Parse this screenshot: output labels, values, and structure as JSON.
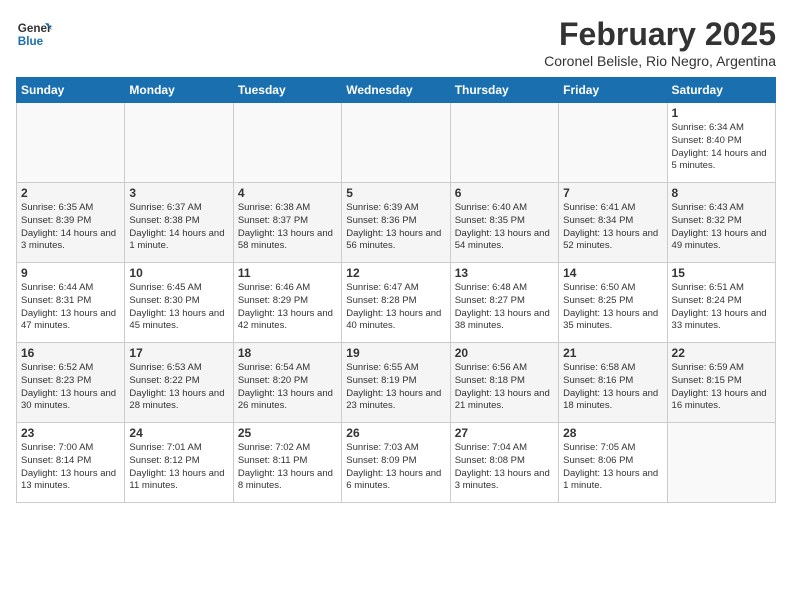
{
  "header": {
    "logo_general": "General",
    "logo_blue": "Blue",
    "month_title": "February 2025",
    "subtitle": "Coronel Belisle, Rio Negro, Argentina"
  },
  "weekdays": [
    "Sunday",
    "Monday",
    "Tuesday",
    "Wednesday",
    "Thursday",
    "Friday",
    "Saturday"
  ],
  "weeks": [
    [
      {
        "day": "",
        "info": ""
      },
      {
        "day": "",
        "info": ""
      },
      {
        "day": "",
        "info": ""
      },
      {
        "day": "",
        "info": ""
      },
      {
        "day": "",
        "info": ""
      },
      {
        "day": "",
        "info": ""
      },
      {
        "day": "1",
        "info": "Sunrise: 6:34 AM\nSunset: 8:40 PM\nDaylight: 14 hours\nand 5 minutes."
      }
    ],
    [
      {
        "day": "2",
        "info": "Sunrise: 6:35 AM\nSunset: 8:39 PM\nDaylight: 14 hours\nand 3 minutes."
      },
      {
        "day": "3",
        "info": "Sunrise: 6:37 AM\nSunset: 8:38 PM\nDaylight: 14 hours\nand 1 minute."
      },
      {
        "day": "4",
        "info": "Sunrise: 6:38 AM\nSunset: 8:37 PM\nDaylight: 13 hours\nand 58 minutes."
      },
      {
        "day": "5",
        "info": "Sunrise: 6:39 AM\nSunset: 8:36 PM\nDaylight: 13 hours\nand 56 minutes."
      },
      {
        "day": "6",
        "info": "Sunrise: 6:40 AM\nSunset: 8:35 PM\nDaylight: 13 hours\nand 54 minutes."
      },
      {
        "day": "7",
        "info": "Sunrise: 6:41 AM\nSunset: 8:34 PM\nDaylight: 13 hours\nand 52 minutes."
      },
      {
        "day": "8",
        "info": "Sunrise: 6:43 AM\nSunset: 8:32 PM\nDaylight: 13 hours\nand 49 minutes."
      }
    ],
    [
      {
        "day": "9",
        "info": "Sunrise: 6:44 AM\nSunset: 8:31 PM\nDaylight: 13 hours\nand 47 minutes."
      },
      {
        "day": "10",
        "info": "Sunrise: 6:45 AM\nSunset: 8:30 PM\nDaylight: 13 hours\nand 45 minutes."
      },
      {
        "day": "11",
        "info": "Sunrise: 6:46 AM\nSunset: 8:29 PM\nDaylight: 13 hours\nand 42 minutes."
      },
      {
        "day": "12",
        "info": "Sunrise: 6:47 AM\nSunset: 8:28 PM\nDaylight: 13 hours\nand 40 minutes."
      },
      {
        "day": "13",
        "info": "Sunrise: 6:48 AM\nSunset: 8:27 PM\nDaylight: 13 hours\nand 38 minutes."
      },
      {
        "day": "14",
        "info": "Sunrise: 6:50 AM\nSunset: 8:25 PM\nDaylight: 13 hours\nand 35 minutes."
      },
      {
        "day": "15",
        "info": "Sunrise: 6:51 AM\nSunset: 8:24 PM\nDaylight: 13 hours\nand 33 minutes."
      }
    ],
    [
      {
        "day": "16",
        "info": "Sunrise: 6:52 AM\nSunset: 8:23 PM\nDaylight: 13 hours\nand 30 minutes."
      },
      {
        "day": "17",
        "info": "Sunrise: 6:53 AM\nSunset: 8:22 PM\nDaylight: 13 hours\nand 28 minutes."
      },
      {
        "day": "18",
        "info": "Sunrise: 6:54 AM\nSunset: 8:20 PM\nDaylight: 13 hours\nand 26 minutes."
      },
      {
        "day": "19",
        "info": "Sunrise: 6:55 AM\nSunset: 8:19 PM\nDaylight: 13 hours\nand 23 minutes."
      },
      {
        "day": "20",
        "info": "Sunrise: 6:56 AM\nSunset: 8:18 PM\nDaylight: 13 hours\nand 21 minutes."
      },
      {
        "day": "21",
        "info": "Sunrise: 6:58 AM\nSunset: 8:16 PM\nDaylight: 13 hours\nand 18 minutes."
      },
      {
        "day": "22",
        "info": "Sunrise: 6:59 AM\nSunset: 8:15 PM\nDaylight: 13 hours\nand 16 minutes."
      }
    ],
    [
      {
        "day": "23",
        "info": "Sunrise: 7:00 AM\nSunset: 8:14 PM\nDaylight: 13 hours\nand 13 minutes."
      },
      {
        "day": "24",
        "info": "Sunrise: 7:01 AM\nSunset: 8:12 PM\nDaylight: 13 hours\nand 11 minutes."
      },
      {
        "day": "25",
        "info": "Sunrise: 7:02 AM\nSunset: 8:11 PM\nDaylight: 13 hours\nand 8 minutes."
      },
      {
        "day": "26",
        "info": "Sunrise: 7:03 AM\nSunset: 8:09 PM\nDaylight: 13 hours\nand 6 minutes."
      },
      {
        "day": "27",
        "info": "Sunrise: 7:04 AM\nSunset: 8:08 PM\nDaylight: 13 hours\nand 3 minutes."
      },
      {
        "day": "28",
        "info": "Sunrise: 7:05 AM\nSunset: 8:06 PM\nDaylight: 13 hours\nand 1 minute."
      },
      {
        "day": "",
        "info": ""
      }
    ]
  ]
}
